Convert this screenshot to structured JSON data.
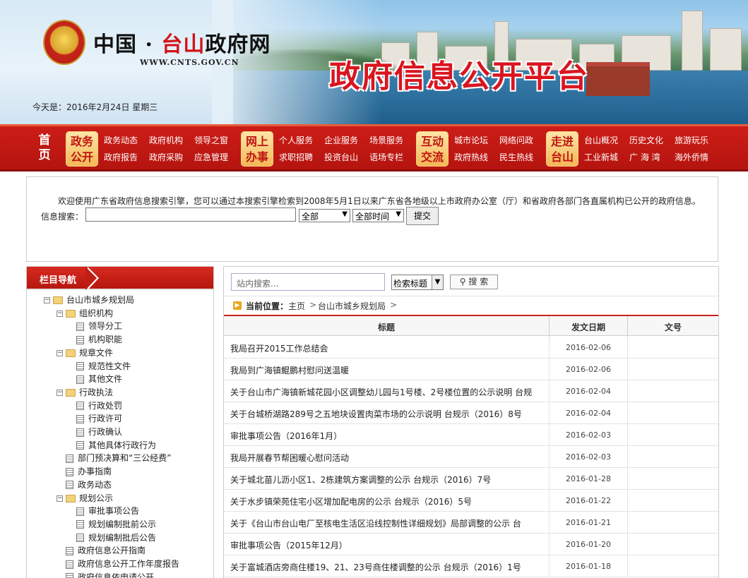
{
  "header": {
    "site_name_a": "中国 · ",
    "site_name_b": "台山",
    "site_name_c": "政府网",
    "site_url": "WWW.CNTS.GOV.CN",
    "platform_title": "政府信息公开平台",
    "today": "今天是：2016年2月24日 星期三"
  },
  "nav": {
    "home": "首页",
    "categories": [
      {
        "label": "政务公开",
        "links": [
          "政务动态",
          "政府机构",
          "领导之窗",
          "政府报告",
          "政府采购",
          "应急管理"
        ]
      },
      {
        "label": "网上办事",
        "links": [
          "个人服务",
          "企业服务",
          "场景服务",
          "求职招聘",
          "投资台山",
          "语场专栏"
        ]
      },
      {
        "label": "互动交流",
        "links": [
          "城市论坛",
          "网络问政",
          "政府热线",
          "民生热线"
        ]
      },
      {
        "label": "走进台山",
        "links": [
          "台山概况",
          "历史文化",
          "旅游玩乐",
          "工业新城",
          "广 海 湾",
          "海外侨情"
        ]
      }
    ]
  },
  "info_search": {
    "welcome": "欢迎使用广东省政府信息搜索引擎，您可以通过本搜索引擎检索到2008年5月1日以来广东省各地级以上市政府办公室（厅）和省政府各部门各直属机构已公开的政府信息。",
    "label": "信息搜索：",
    "input_value": "",
    "scope_selected": "全部",
    "time_selected": "全部时间",
    "submit": "提交"
  },
  "sidebar": {
    "title": "栏目导航",
    "tree": [
      {
        "label": "台山市城乡规划局",
        "toggle": "−",
        "icon": "folder"
      },
      {
        "label": "组织机构",
        "toggle": "−",
        "icon": "folder"
      },
      {
        "label": "领导分工",
        "toggle": "",
        "icon": "doc"
      },
      {
        "label": "机构职能",
        "toggle": "",
        "icon": "doc"
      },
      {
        "label": "规章文件",
        "toggle": "−",
        "icon": "folder"
      },
      {
        "label": "规范性文件",
        "toggle": "",
        "icon": "doc"
      },
      {
        "label": "其他文件",
        "toggle": "",
        "icon": "doc"
      },
      {
        "label": "行政执法",
        "toggle": "−",
        "icon": "folder"
      },
      {
        "label": "行政处罚",
        "toggle": "",
        "icon": "doc"
      },
      {
        "label": "行政许可",
        "toggle": "",
        "icon": "doc"
      },
      {
        "label": "行政确认",
        "toggle": "",
        "icon": "doc"
      },
      {
        "label": "其他具体行政行为",
        "toggle": "",
        "icon": "doc"
      },
      {
        "label": "部门预决算和“三公经费”",
        "toggle": "",
        "icon": "doc"
      },
      {
        "label": "办事指南",
        "toggle": "",
        "icon": "doc"
      },
      {
        "label": "政务动态",
        "toggle": "",
        "icon": "doc"
      },
      {
        "label": "规划公示",
        "toggle": "−",
        "icon": "folder"
      },
      {
        "label": "审批事项公告",
        "toggle": "",
        "icon": "doc"
      },
      {
        "label": "规划编制批前公示",
        "toggle": "",
        "icon": "doc"
      },
      {
        "label": "规划编制批后公告",
        "toggle": "",
        "icon": "doc"
      },
      {
        "label": "政府信息公开指南",
        "toggle": "",
        "icon": "doc"
      },
      {
        "label": "政府信息公开工作年度报告",
        "toggle": "",
        "icon": "doc"
      },
      {
        "label": "政府信息依申请公开",
        "toggle": "",
        "icon": "doc"
      }
    ]
  },
  "main": {
    "search_placeholder": "站内搜索...",
    "search_scope": "检索标题",
    "search_button": "搜 索",
    "breadcrumb_label": "当前位置：",
    "breadcrumb": [
      "主页",
      "台山市城乡规划局"
    ],
    "columns": [
      "标题",
      "发文日期",
      "文号"
    ],
    "rows": [
      {
        "title": "我局召开2015工作总结会",
        "date": "2016-02-06",
        "number": ""
      },
      {
        "title": "我局到广海镇鲲鹏村慰问送温暖",
        "date": "2016-02-06",
        "number": ""
      },
      {
        "title": "关于台山市广海镇新城花园小区调整幼儿园与1号楼、2号楼位置的公示说明 台规",
        "date": "2016-02-04",
        "number": ""
      },
      {
        "title": "关于台城桥湖路289号之五地块设置肉菜市场的公示说明 台规示（2016）8号",
        "date": "2016-02-04",
        "number": ""
      },
      {
        "title": "审批事项公告（2016年1月）",
        "date": "2016-02-03",
        "number": ""
      },
      {
        "title": "我局开展春节帮困暖心慰问活动",
        "date": "2016-02-03",
        "number": ""
      },
      {
        "title": "关于城北苗儿沥小区1、2栋建筑方案调整的公示 台规示（2016）7号",
        "date": "2016-01-28",
        "number": ""
      },
      {
        "title": "关于水步镇荣苑住宅小区增加配电房的公示 台规示（2016）5号",
        "date": "2016-01-22",
        "number": ""
      },
      {
        "title": "关于《台山市台山电厂至核电生活区沿线控制性详细规划》局部调整的公示 台",
        "date": "2016-01-21",
        "number": ""
      },
      {
        "title": "审批事项公告（2015年12月）",
        "date": "2016-01-20",
        "number": ""
      },
      {
        "title": "关于富城酒店旁商住楼19、21、23号商住楼调整的公示 台规示（2016）1号",
        "date": "2016-01-18",
        "number": ""
      }
    ]
  }
}
